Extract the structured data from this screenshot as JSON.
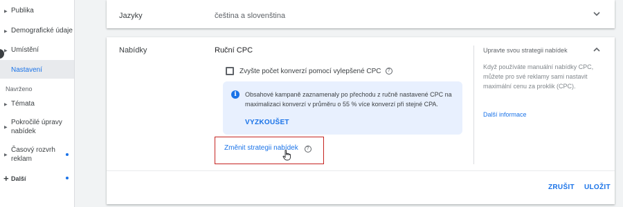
{
  "sidebar": {
    "items": [
      {
        "label": "Publika"
      },
      {
        "label": "Demografické údaje"
      },
      {
        "label": "Umístění"
      },
      {
        "label": "Nastavení"
      }
    ],
    "section_label": "Navrženo",
    "suggested": [
      {
        "label": "Témata"
      },
      {
        "label": "Pokročilé úpravy nabídek"
      },
      {
        "label": "Časový rozvrh reklam"
      }
    ],
    "more_label": "Další"
  },
  "languages_card": {
    "title": "Jazyky",
    "value": "čeština a slovenština"
  },
  "bids_card": {
    "title": "Nabídky",
    "strategy": "Ruční CPC",
    "checkbox_label": "Zvyšte počet konverzí pomocí vylepšené CPC",
    "info_text": "Obsahové kampaně zaznamenaly po přechodu z ručně nastavené CPC na maximalizaci konverzí v průměru o 55 % více konverzí při stejné CPA.",
    "try_label": "VYZKOUŠET",
    "change_link": "Změnit strategii nabídek",
    "side_title": "Upravte svou strategii nabídek",
    "side_text": "Když používáte manuální nabídky CPC, můžete pro své reklamy sami nastavit maximální cenu za proklik (CPC).",
    "side_link": "Další informace",
    "cancel_label": "ZRUŠIT",
    "save_label": "ULOŽIT"
  },
  "colors": {
    "accent": "#1a73e8",
    "highlight": "#c5221f",
    "info_bg": "#e8f0fe"
  }
}
